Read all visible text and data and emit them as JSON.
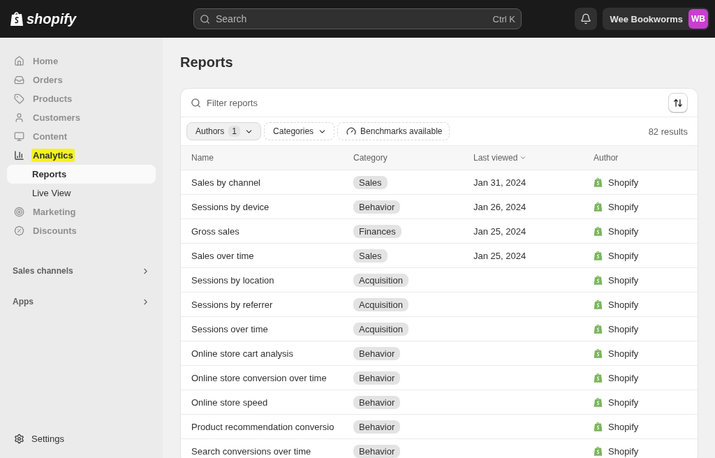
{
  "topbar": {
    "logo": "shopify",
    "search": {
      "placeholder": "Search",
      "shortcut": "Ctrl K"
    },
    "store": {
      "name": "Wee Bookworms",
      "initials": "WB"
    }
  },
  "sidebar": {
    "items": [
      {
        "label": "Home",
        "dimmed": true,
        "highlighted": false,
        "selected": false
      },
      {
        "label": "Orders",
        "dimmed": true,
        "highlighted": false,
        "selected": false
      },
      {
        "label": "Products",
        "dimmed": true,
        "highlighted": false,
        "selected": false
      },
      {
        "label": "Customers",
        "dimmed": true,
        "highlighted": false,
        "selected": false
      },
      {
        "label": "Content",
        "dimmed": true,
        "highlighted": false,
        "selected": false
      },
      {
        "label": "Analytics",
        "dimmed": false,
        "highlighted": true,
        "selected": false,
        "children": [
          {
            "label": "Reports",
            "selected": true
          },
          {
            "label": "Live View",
            "selected": false
          }
        ]
      },
      {
        "label": "Marketing",
        "dimmed": true,
        "highlighted": false,
        "selected": false
      },
      {
        "label": "Discounts",
        "dimmed": true,
        "highlighted": false,
        "selected": false
      }
    ],
    "sections": [
      "Sales channels",
      "Apps"
    ],
    "settings": "Settings"
  },
  "page": {
    "title": "Reports",
    "filter": {
      "placeholder": "Filter reports"
    },
    "chips": [
      {
        "label": "Authors",
        "count": "1",
        "kind": "count"
      },
      {
        "label": "Categories",
        "kind": "dropdown"
      },
      {
        "label": "Benchmarks available",
        "kind": "toggle"
      }
    ],
    "results": "82 results",
    "table": {
      "columns": [
        "Name",
        "Category",
        "Last viewed",
        "Author"
      ],
      "rows": [
        {
          "name": "Sales by channel",
          "category": "Sales",
          "last_viewed": "Jan 31, 2024",
          "author": "Shopify"
        },
        {
          "name": "Sessions by device",
          "category": "Behavior",
          "last_viewed": "Jan 26, 2024",
          "author": "Shopify"
        },
        {
          "name": "Gross sales",
          "category": "Finances",
          "last_viewed": "Jan 25, 2024",
          "author": "Shopify"
        },
        {
          "name": "Sales over time",
          "category": "Sales",
          "last_viewed": "Jan 25, 2024",
          "author": "Shopify"
        },
        {
          "name": "Sessions by location",
          "category": "Acquisition",
          "author": "Shopify"
        },
        {
          "name": "Sessions by referrer",
          "category": "Acquisition",
          "author": "Shopify"
        },
        {
          "name": "Sessions over time",
          "category": "Acquisition",
          "author": "Shopify"
        },
        {
          "name": "Online store cart analysis",
          "category": "Behavior",
          "author": "Shopify"
        },
        {
          "name": "Online store conversion over time",
          "category": "Behavior",
          "author": "Shopify"
        },
        {
          "name": "Online store speed",
          "category": "Behavior",
          "author": "Shopify"
        },
        {
          "name": "Product recommendation conversio",
          "category": "Behavior",
          "author": "Shopify"
        },
        {
          "name": "Search conversions over time",
          "category": "Behavior",
          "author": "Shopify"
        }
      ]
    }
  }
}
